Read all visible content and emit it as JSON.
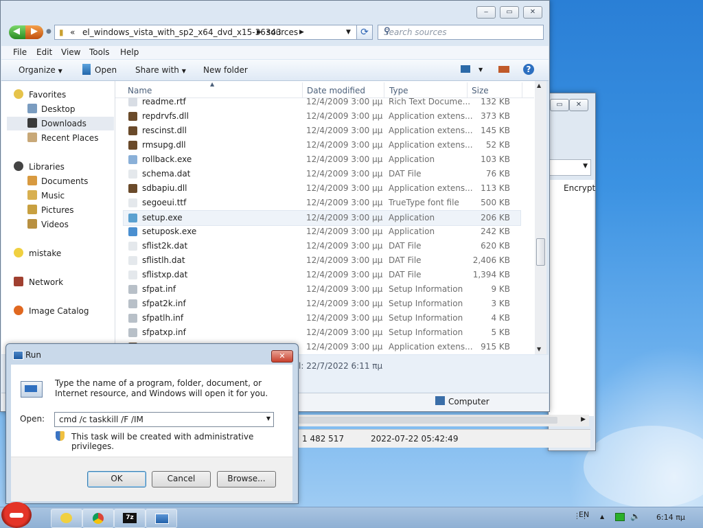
{
  "explorer": {
    "breadcrumb": {
      "prefix": "«",
      "segment1": "el_windows_vista_with_sp2_x64_dvd_x15-36343",
      "segment2": "sources"
    },
    "search_placeholder": "Search sources",
    "menu": [
      "File",
      "Edit",
      "View",
      "Tools",
      "Help"
    ],
    "toolbar": {
      "organize": "Organize",
      "open": "Open",
      "share_with": "Share with",
      "new_folder": "New folder"
    },
    "nav": {
      "favorites": "Favorites",
      "desktop": "Desktop",
      "downloads": "Downloads",
      "recent": "Recent Places",
      "libraries": "Libraries",
      "documents": "Documents",
      "music": "Music",
      "pictures": "Pictures",
      "videos": "Videos",
      "user": "mistake",
      "network": "Network",
      "catalog": "Image Catalog"
    },
    "columns": {
      "name": "Name",
      "date": "Date modified",
      "type": "Type",
      "size": "Size"
    },
    "files": [
      {
        "name": "readme.rtf",
        "date": "12/4/2009 3:00 μμ",
        "type": "Rich Text Docume...",
        "size": "132 KB",
        "icon_color": "#d8dde4"
      },
      {
        "name": "repdrvfs.dll",
        "date": "12/4/2009 3:00 μμ",
        "type": "Application extens...",
        "size": "373 KB",
        "icon_color": "#6a4a2a"
      },
      {
        "name": "rescinst.dll",
        "date": "12/4/2009 3:00 μμ",
        "type": "Application extens...",
        "size": "145 KB",
        "icon_color": "#6a4a2a"
      },
      {
        "name": "rmsupg.dll",
        "date": "12/4/2009 3:00 μμ",
        "type": "Application extens...",
        "size": "52 KB",
        "icon_color": "#6a4a2a"
      },
      {
        "name": "rollback.exe",
        "date": "12/4/2009 3:00 μμ",
        "type": "Application",
        "size": "103 KB",
        "icon_color": "#8ab0d8"
      },
      {
        "name": "schema.dat",
        "date": "12/4/2009 3:00 μμ",
        "type": "DAT File",
        "size": "76 KB",
        "icon_color": "#e4e8ec"
      },
      {
        "name": "sdbapiu.dll",
        "date": "12/4/2009 3:00 μμ",
        "type": "Application extens...",
        "size": "113 KB",
        "icon_color": "#6a4a2a"
      },
      {
        "name": "segoeui.ttf",
        "date": "12/4/2009 3:00 μμ",
        "type": "TrueType font file",
        "size": "500 KB",
        "icon_color": "#e4e8ec"
      },
      {
        "name": "setup.exe",
        "date": "12/4/2009 3:00 μμ",
        "type": "Application",
        "size": "206 KB",
        "icon_color": "#5aa0d0"
      },
      {
        "name": "setuposk.exe",
        "date": "12/4/2009 3:00 μμ",
        "type": "Application",
        "size": "242 KB",
        "icon_color": "#4a8fd0"
      },
      {
        "name": "sflist2k.dat",
        "date": "12/4/2009 3:00 μμ",
        "type": "DAT File",
        "size": "620 KB",
        "icon_color": "#e4e8ec"
      },
      {
        "name": "sflistlh.dat",
        "date": "12/4/2009 3:00 μμ",
        "type": "DAT File",
        "size": "2,406 KB",
        "icon_color": "#e4e8ec"
      },
      {
        "name": "sflistxp.dat",
        "date": "12/4/2009 3:00 μμ",
        "type": "DAT File",
        "size": "1,394 KB",
        "icon_color": "#e4e8ec"
      },
      {
        "name": "sfpat.inf",
        "date": "12/4/2009 3:00 μμ",
        "type": "Setup Information",
        "size": "9 KB",
        "icon_color": "#b8c0c8"
      },
      {
        "name": "sfpat2k.inf",
        "date": "12/4/2009 3:00 μμ",
        "type": "Setup Information",
        "size": "3 KB",
        "icon_color": "#b8c0c8"
      },
      {
        "name": "sfpatlh.inf",
        "date": "12/4/2009 3:00 μμ",
        "type": "Setup Information",
        "size": "4 KB",
        "icon_color": "#b8c0c8"
      },
      {
        "name": "sfpatxp.inf",
        "date": "12/4/2009 3:00 μμ",
        "type": "Setup Information",
        "size": "5 KB",
        "icon_color": "#b8c0c8"
      },
      {
        "name": "",
        "date": "12/4/2009 3:00 μμ",
        "type": "Application extens...",
        "size": "915 KB",
        "icon_color": "#6a4a2a"
      }
    ],
    "details_text": "l:  22/7/2022 6:11 πμ",
    "status_computer": "Computer"
  },
  "back_window": {
    "column_label": "Encrypt",
    "status_size": "1 482 517",
    "status_date": "2022-07-22 05:42:49"
  },
  "run": {
    "title": "Run",
    "description": "Type the name of a program, folder, document, or Internet resource, and Windows will open it for you.",
    "open_label": "Open:",
    "command": "cmd /c taskkill /F /IM",
    "admin_note": "This task will be created with administrative privileges.",
    "ok": "OK",
    "cancel": "Cancel",
    "browse": "Browse..."
  },
  "tray": {
    "lang": "EN",
    "time": "6:14 πμ"
  },
  "taskbar": {
    "sevenzip_label": "7z"
  }
}
